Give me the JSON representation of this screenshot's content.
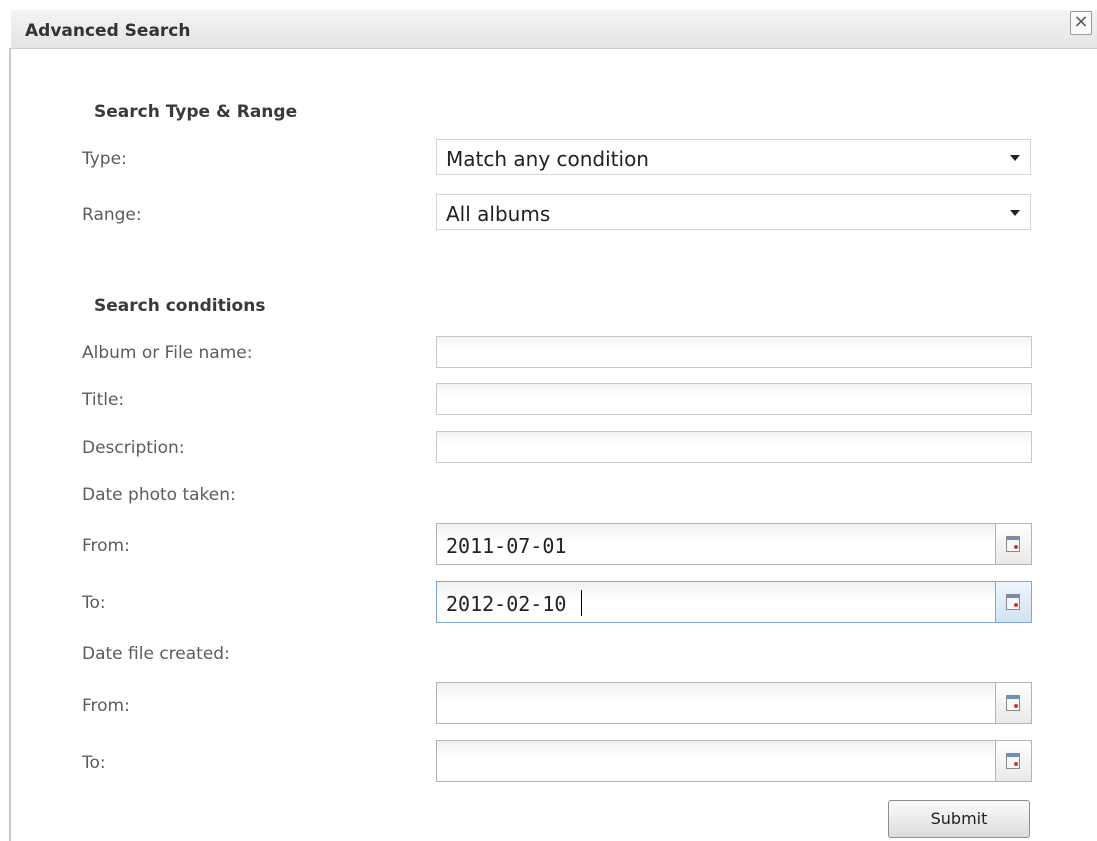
{
  "dialog": {
    "title": "Advanced Search",
    "close_label": "×"
  },
  "type_range": {
    "heading": "Search Type & Range",
    "type_label": "Type:",
    "type_value": "Match any condition",
    "range_label": "Range:",
    "range_value": "All albums"
  },
  "conditions": {
    "heading": "Search conditions",
    "album_label": "Album or File name:",
    "album_value": "",
    "title_label": "Title:",
    "title_value": "",
    "description_label": "Description:",
    "description_value": "",
    "date_taken_label": "Date photo taken:",
    "taken_from_label": "From:",
    "taken_from_value": "2011-07-01",
    "taken_to_label": "To:",
    "taken_to_value": "2012-02-10",
    "date_created_label": "Date file created:",
    "created_from_label": "From:",
    "created_from_value": "",
    "created_to_label": "To:",
    "created_to_value": ""
  },
  "submit_label": "Submit",
  "icons": {
    "close": "close-icon",
    "dropdown": "chevron-down-icon",
    "calendar": "calendar-icon"
  }
}
